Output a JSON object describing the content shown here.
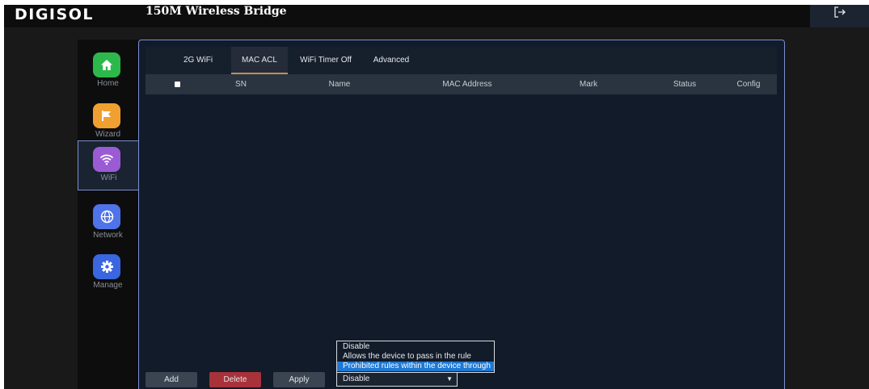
{
  "header": {
    "logo": "DIGISOL",
    "title": "150M Wireless Bridge"
  },
  "nav": [
    {
      "label": "Home",
      "icon": "home-icon",
      "color": "#2db84b",
      "active": false
    },
    {
      "label": "Wizard",
      "icon": "flag-icon",
      "color": "#f0a030",
      "active": false
    },
    {
      "label": "WiFi",
      "icon": "wifi-icon",
      "color": "#9b5bd4",
      "active": true
    },
    {
      "label": "Network",
      "icon": "globe-icon",
      "color": "#4f73e8",
      "active": false
    },
    {
      "label": "Manage",
      "icon": "gear-icon",
      "color": "#3a66e0",
      "active": false
    }
  ],
  "tabs": [
    {
      "label": "2G WiFi",
      "active": false
    },
    {
      "label": "MAC ACL",
      "active": true
    },
    {
      "label": "WiFi Timer Off",
      "active": false
    },
    {
      "label": "Advanced",
      "active": false
    }
  ],
  "table": {
    "columns": [
      "SN",
      "Name",
      "MAC Address",
      "Mark",
      "Status",
      "Config"
    ],
    "rows": []
  },
  "actions": {
    "add": "Add",
    "delete": "Delete",
    "apply": "Apply"
  },
  "rule_select": {
    "value": "Disable",
    "options": [
      "Disable",
      "Allows the device to pass in the rule",
      "Prohibited rules within the device through"
    ],
    "highlighted": "Prohibited rules within the device through"
  },
  "colors": {
    "accent_tab": "#c98a56",
    "panel_border": "#7a8fcf",
    "delete_button": "#a8323a",
    "selected_option": "#1e78d4"
  }
}
